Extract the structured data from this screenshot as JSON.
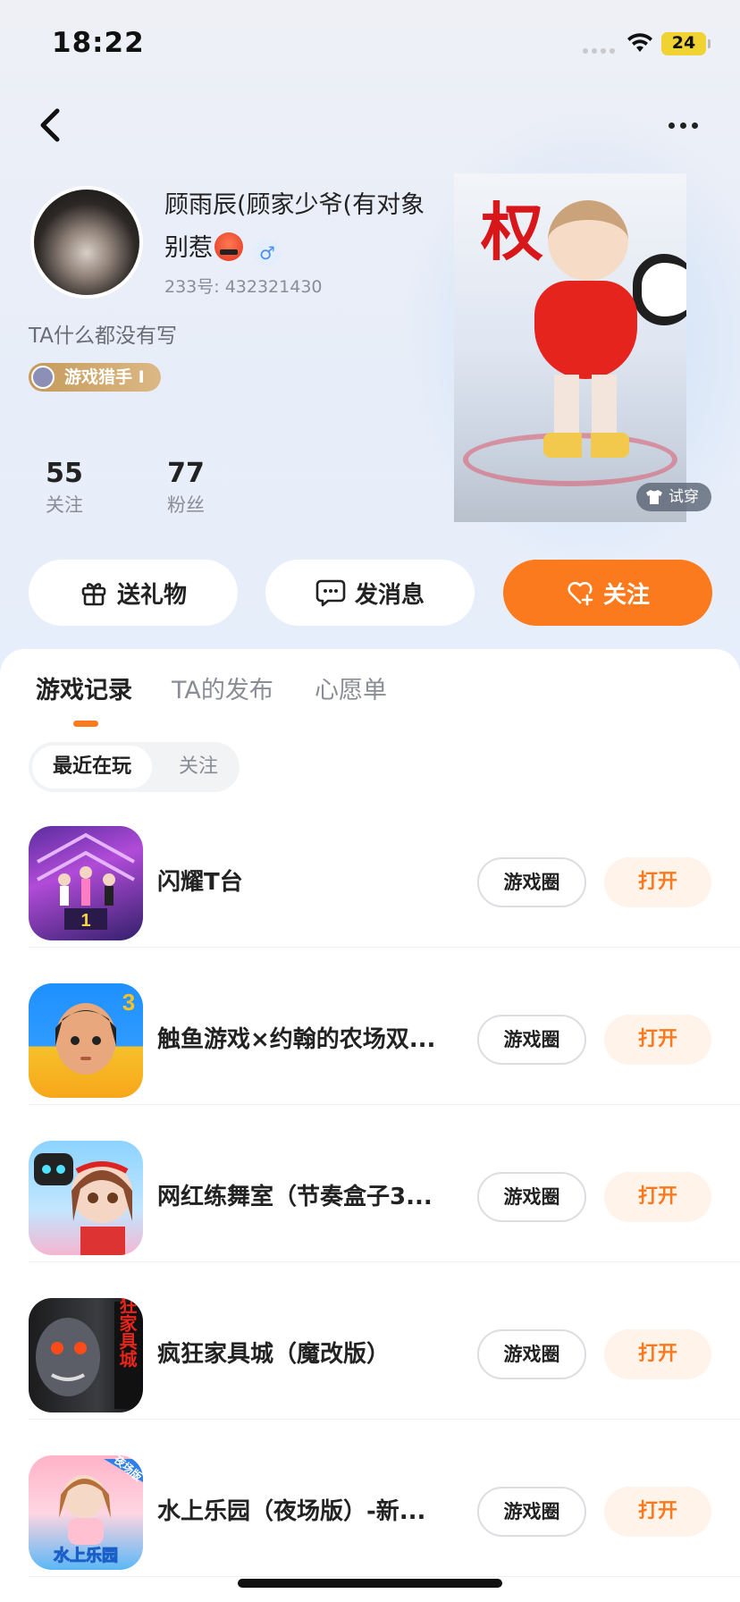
{
  "status_bar": {
    "time": "18:22",
    "battery": "24",
    "battery_level": 0.24
  },
  "profile": {
    "nickname_line1": "顾雨辰(顾家少爷(有对象",
    "nickname_line2": "别惹",
    "gender": "♂",
    "user_id": "233号: 432321430",
    "bio": "TA什么都没有写",
    "title_badge": "游戏猎手 I",
    "stats": [
      {
        "value": "55",
        "label": "关注"
      },
      {
        "value": "77",
        "label": "粉丝"
      }
    ],
    "figure_text": "权",
    "try_on_label": "试穿"
  },
  "actions": {
    "gift_label": "送礼物",
    "message_label": "发消息",
    "follow_label": "关注",
    "accent_color": "#fb7a1d"
  },
  "tabs": [
    {
      "label": "游戏记录",
      "active": true
    },
    {
      "label": "TA的发布",
      "active": false
    },
    {
      "label": "心愿单",
      "active": false
    }
  ],
  "segment": {
    "active": "最近在玩",
    "inactive": "关注"
  },
  "games": [
    {
      "name": "闪耀T台",
      "icon": "runway-game-icon",
      "circle_label": "游戏圈",
      "open_label": "打开"
    },
    {
      "name": "触鱼游戏×约翰的农场双...",
      "icon": "squid-doll-game-icon",
      "circle_label": "游戏圈",
      "open_label": "打开"
    },
    {
      "name": "网红练舞室（节奏盒子3...",
      "icon": "dance-room-game-icon",
      "circle_label": "游戏圈",
      "open_label": "打开"
    },
    {
      "name": "疯狂家具城（魔改版）",
      "icon": "furniture-city-game-icon",
      "circle_label": "游戏圈",
      "open_label": "打开"
    },
    {
      "name": "水上乐园（夜场版）-新...",
      "icon": "water-park-game-icon",
      "circle_label": "游戏圈",
      "open_label": "打开"
    }
  ],
  "game_icon_texts": {
    "icon4": "疯狂家具城",
    "icon5": "水上乐园",
    "icon5_tag": "夜场版"
  }
}
